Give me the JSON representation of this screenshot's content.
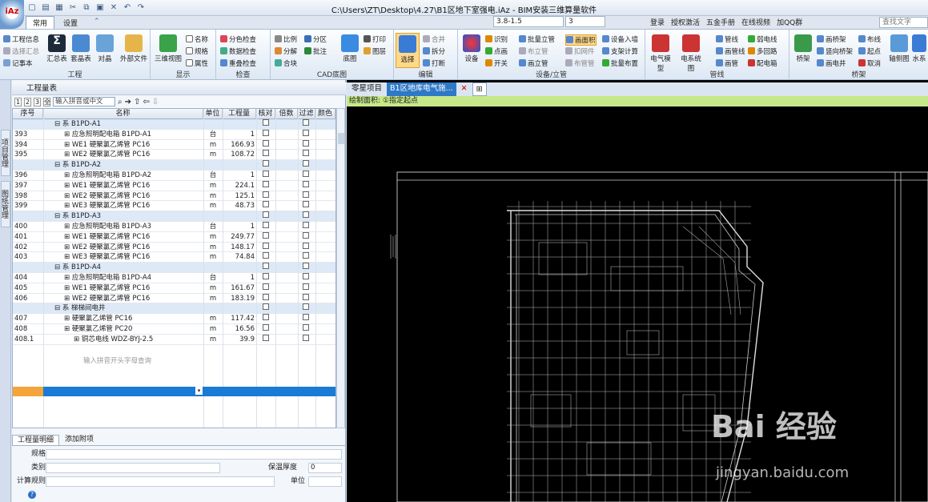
{
  "app": {
    "title": "C:\\Users\\ZT\\Desktop\\4.27\\B1区地下室强电.iAz - BIM安装三维算量软件",
    "logo": "iAz"
  },
  "tabs": [
    {
      "label": "常用"
    },
    {
      "label": "设置"
    }
  ],
  "combos": {
    "floor": "3.8-1.5",
    "num": "3"
  },
  "right_tools": [
    "登录",
    "授权激活",
    "五金手册",
    "在线视频",
    "加QQ群"
  ],
  "search_placeholder": "查找文字",
  "ribbon": {
    "g1": {
      "label": "工程",
      "items": [
        "工程信息",
        "选择汇总",
        "记事本",
        "汇总表",
        "套晶表",
        "对晶",
        "外部文件"
      ]
    },
    "g2": {
      "label": "显示",
      "items": [
        "三维视图",
        "名称",
        "规格",
        "属性"
      ]
    },
    "g3": {
      "label": "检查",
      "items": [
        "分色检查",
        "数据检查",
        "重叠检查"
      ]
    },
    "g4": {
      "label": "CAD底图",
      "items": [
        "比例",
        "分区",
        "分解",
        "批注",
        "合块",
        "底图",
        "打印",
        "图层"
      ]
    },
    "g5": {
      "label": "编辑",
      "items": [
        "选择",
        "合并",
        "拆分",
        "打断"
      ]
    },
    "g6": {
      "label": "设备/立管",
      "items": [
        "设备",
        "识别",
        "批量立管",
        "画面积",
        "设备入墙",
        "点画",
        "布立管",
        "扣网件",
        "支架计算",
        "开关",
        "画立管",
        "布管管",
        "批量布置"
      ]
    },
    "g7": {
      "label": "管线",
      "items": [
        "电气模型",
        "电系统图",
        "管线",
        "画管线",
        "画管",
        "弱电线",
        "多回路",
        "配电箱"
      ]
    },
    "g8": {
      "label": "桥架",
      "items": [
        "桥架",
        "画桥架",
        "竖向桥架",
        "画电井",
        "布线",
        "起点",
        "取消",
        "轴侧图",
        "水系"
      ]
    }
  },
  "panel": {
    "title": "工程量表",
    "levels": [
      "1",
      "2",
      "3",
      "全"
    ],
    "input_value": "输入拼音或中文",
    "columns": [
      "序号",
      "名称",
      "单位",
      "工程量",
      "核对",
      "倍数",
      "过滤",
      "颜色"
    ],
    "rows": [
      {
        "seq": "",
        "name": "系 B1PD-A1",
        "unit": "",
        "qty": "",
        "sys": true,
        "ind": 1
      },
      {
        "seq": "393",
        "name": "应急照明配电箱 B1PD-A1",
        "unit": "台",
        "qty": "1",
        "ind": 2
      },
      {
        "seq": "394",
        "name": "WE1 硬聚氯乙烯管 PC16",
        "unit": "m",
        "qty": "166.93",
        "ind": 2
      },
      {
        "seq": "395",
        "name": "WE2 硬聚氯乙烯管 PC16",
        "unit": "m",
        "qty": "108.72",
        "ind": 2
      },
      {
        "seq": "",
        "name": "系 B1PD-A2",
        "unit": "",
        "qty": "",
        "sys": true,
        "ind": 1
      },
      {
        "seq": "396",
        "name": "应急照明配电箱 B1PD-A2",
        "unit": "台",
        "qty": "1",
        "ind": 2
      },
      {
        "seq": "397",
        "name": "WE1 硬聚氯乙烯管 PC16",
        "unit": "m",
        "qty": "224.1",
        "ind": 2
      },
      {
        "seq": "398",
        "name": "WE2 硬聚氯乙烯管 PC16",
        "unit": "m",
        "qty": "125.1",
        "ind": 2
      },
      {
        "seq": "399",
        "name": "WE3 硬聚氯乙烯管 PC16",
        "unit": "m",
        "qty": "48.73",
        "ind": 2
      },
      {
        "seq": "",
        "name": "系 B1PD-A3",
        "unit": "",
        "qty": "",
        "sys": true,
        "ind": 1
      },
      {
        "seq": "400",
        "name": "应急照明配电箱 B1PD-A3",
        "unit": "台",
        "qty": "1",
        "ind": 2
      },
      {
        "seq": "401",
        "name": "WE1 硬聚氯乙烯管 PC16",
        "unit": "m",
        "qty": "249.77",
        "ind": 2
      },
      {
        "seq": "402",
        "name": "WE2 硬聚氯乙烯管 PC16",
        "unit": "m",
        "qty": "148.17",
        "ind": 2
      },
      {
        "seq": "403",
        "name": "WE3 硬聚氯乙烯管 PC16",
        "unit": "m",
        "qty": "74.84",
        "ind": 2
      },
      {
        "seq": "",
        "name": "系 B1PD-A4",
        "unit": "",
        "qty": "",
        "sys": true,
        "ind": 1
      },
      {
        "seq": "404",
        "name": "应急照明配电箱 B1PD-A4",
        "unit": "台",
        "qty": "1",
        "ind": 2
      },
      {
        "seq": "405",
        "name": "WE1 硬聚氯乙烯管 PC16",
        "unit": "m",
        "qty": "161.67",
        "ind": 2
      },
      {
        "seq": "406",
        "name": "WE2 硬聚氯乙烯管 PC16",
        "unit": "m",
        "qty": "183.19",
        "ind": 2
      },
      {
        "seq": "",
        "name": "系 梯梯间电井",
        "unit": "",
        "qty": "",
        "sys": true,
        "ind": 1
      },
      {
        "seq": "407",
        "name": "硬聚氯乙烯管 PC16",
        "unit": "m",
        "qty": "117.42",
        "ind": 2
      },
      {
        "seq": "408",
        "name": "硬聚氯乙烯管 PC20",
        "unit": "m",
        "qty": "16.56",
        "ind": 2
      },
      {
        "seq": "408.1",
        "name": "铜芯电线 WDZ-BYJ-2.5",
        "unit": "m",
        "qty": "39.9",
        "ind": 3
      }
    ],
    "hint": "输入拼音开头字母查询",
    "bottom_tabs": [
      "工程量明细",
      "添加附项"
    ],
    "props": {
      "spec": "规格",
      "category": "类别",
      "rule": "计算规则",
      "insul": "保温厚度",
      "insul_val": "0",
      "unit": "单位"
    }
  },
  "doc_tabs": {
    "a": "零星项目",
    "b": "B1区地库电气施..."
  },
  "cmd": {
    "prefix": "绘制面积:",
    "text": "①指定起点"
  },
  "watermark": {
    "line1": "Bai 经验",
    "line2": "jingyan.baidu.com"
  }
}
